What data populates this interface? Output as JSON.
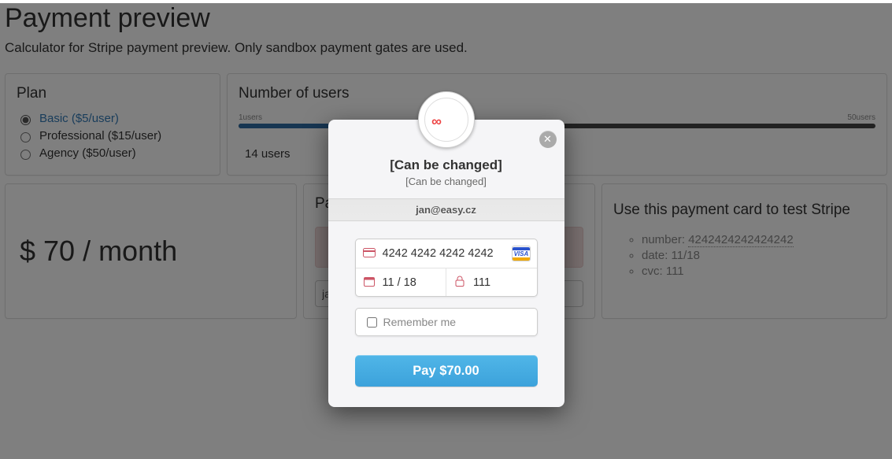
{
  "page": {
    "title": "Payment preview",
    "subtitle": "Calculator for Stripe payment preview. Only sandbox payment gates are used."
  },
  "plan": {
    "heading": "Plan",
    "options": [
      {
        "label": "Basic ($5/user)",
        "selected": true
      },
      {
        "label": "Professional ($15/user)",
        "selected": false
      },
      {
        "label": "Agency ($50/user)",
        "selected": false
      }
    ]
  },
  "users": {
    "heading": "Number of users",
    "min_label": "1users",
    "max_label": "50users",
    "value": 14,
    "percent": 27,
    "count_text_prefix": "14",
    "count_text_suffix": "  users"
  },
  "price": {
    "text": "$ 70 / month"
  },
  "pay_select": {
    "heading": "Pa",
    "email_value": "jan@easy.cz"
  },
  "test_card": {
    "heading": "Use this payment card to test Stripe",
    "items": [
      {
        "label": "number: ",
        "value": "4242424242424242",
        "dotted": true
      },
      {
        "label": "date: ",
        "value": "11/18",
        "dotted": false
      },
      {
        "label": "cvc: ",
        "value": "111",
        "dotted": false
      }
    ]
  },
  "modal": {
    "logo_text": "∞",
    "title": "[Can be changed]",
    "subtitle": "[Can be changed]",
    "email": "jan@easy.cz",
    "card_number": "4242 4242 4242 4242",
    "card_brand": "VISA",
    "expiry": "11 / 18",
    "cvc": "111",
    "remember_label": "Remember me",
    "pay_button": "Pay $70.00"
  }
}
